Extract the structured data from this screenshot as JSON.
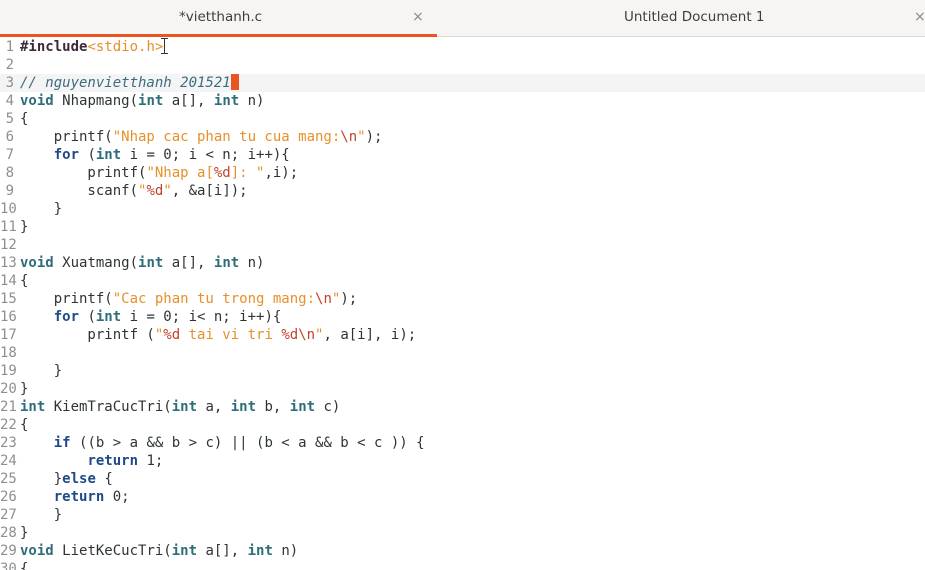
{
  "tabs": [
    {
      "label": "*vietthanh.c",
      "close": "×",
      "active": true
    },
    {
      "label": "Untitled Document 1",
      "close": "×",
      "active": false
    }
  ],
  "colors": {
    "accent": "#e95420",
    "keyword": "#204a87",
    "string": "#e6902a",
    "comment": "#3b6d80"
  },
  "editor": {
    "current_line": 3,
    "lines": [
      {
        "n": "1",
        "tokens": [
          [
            "pp",
            "#include"
          ],
          [
            "inc",
            "<stdio.h>"
          ]
        ]
      },
      {
        "n": "2",
        "tokens": []
      },
      {
        "n": "3",
        "tokens": [
          [
            "cm",
            "// nguyenvietthanh 201521"
          ]
        ]
      },
      {
        "n": "4",
        "tokens": [
          [
            "ty",
            "void"
          ],
          [
            "",
            "Nhapmang("
          ],
          [
            "ty",
            "int"
          ],
          [
            "",
            "a[], "
          ],
          [
            "ty",
            "int"
          ],
          [
            "",
            "n)"
          ]
        ]
      },
      {
        "n": "5",
        "tokens": [
          [
            "",
            "{"
          ]
        ]
      },
      {
        "n": "6",
        "tokens": [
          [
            "",
            "    printf("
          ],
          [
            "str",
            "\"Nhap cac phan tu cua mang:"
          ],
          [
            "esc",
            "\\n"
          ],
          [
            "str",
            "\""
          ],
          [
            "",
            ");"
          ]
        ]
      },
      {
        "n": "7",
        "tokens": [
          [
            "",
            "    "
          ],
          [
            "kw",
            "for"
          ],
          [
            "",
            "("
          ],
          [
            "ty",
            "int"
          ],
          [
            "",
            "i = 0; i < n; i++){"
          ]
        ]
      },
      {
        "n": "8",
        "tokens": [
          [
            "",
            "        printf("
          ],
          [
            "str",
            "\"Nhap a["
          ],
          [
            "esc",
            "%d"
          ],
          [
            "str",
            "]: \""
          ],
          [
            "",
            ",i);"
          ]
        ]
      },
      {
        "n": "9",
        "tokens": [
          [
            "",
            "        scanf("
          ],
          [
            "str",
            "\""
          ],
          [
            "esc",
            "%d"
          ],
          [
            "str",
            "\""
          ],
          [
            "",
            ", &a[i]);"
          ]
        ]
      },
      {
        "n": "10",
        "tokens": [
          [
            "",
            "    }"
          ]
        ]
      },
      {
        "n": "11",
        "tokens": [
          [
            "",
            "}"
          ]
        ]
      },
      {
        "n": "12",
        "tokens": []
      },
      {
        "n": "13",
        "tokens": [
          [
            "ty",
            "void"
          ],
          [
            "",
            "Xuatmang("
          ],
          [
            "ty",
            "int"
          ],
          [
            "",
            "a[], "
          ],
          [
            "ty",
            "int"
          ],
          [
            "",
            "n)"
          ]
        ]
      },
      {
        "n": "14",
        "tokens": [
          [
            "",
            "{"
          ]
        ]
      },
      {
        "n": "15",
        "tokens": [
          [
            "",
            "    printf("
          ],
          [
            "str",
            "\"Cac phan tu trong mang:"
          ],
          [
            "esc",
            "\\n"
          ],
          [
            "str",
            "\""
          ],
          [
            "",
            ");"
          ]
        ]
      },
      {
        "n": "16",
        "tokens": [
          [
            "",
            "    "
          ],
          [
            "kw",
            "for"
          ],
          [
            "",
            "("
          ],
          [
            "ty",
            "int"
          ],
          [
            "",
            "i = 0; i< n; i++){"
          ]
        ]
      },
      {
        "n": "17",
        "tokens": [
          [
            "",
            "        printf ("
          ],
          [
            "str",
            "\""
          ],
          [
            "esc",
            "%d"
          ],
          [
            "str",
            " tai vi tri "
          ],
          [
            "esc",
            "%d\\n"
          ],
          [
            "str",
            "\""
          ],
          [
            "",
            ", a[i], i);"
          ]
        ]
      },
      {
        "n": "18",
        "tokens": []
      },
      {
        "n": "19",
        "tokens": [
          [
            "",
            "    }"
          ]
        ]
      },
      {
        "n": "20",
        "tokens": [
          [
            "",
            "}"
          ]
        ]
      },
      {
        "n": "21",
        "tokens": [
          [
            "ty",
            "int"
          ],
          [
            "",
            "KiemTraCucTri("
          ],
          [
            "ty",
            "int"
          ],
          [
            "",
            "a, "
          ],
          [
            "ty",
            "int"
          ],
          [
            "",
            "b, "
          ],
          [
            "ty",
            "int"
          ],
          [
            "",
            "c)"
          ]
        ]
      },
      {
        "n": "22",
        "tokens": [
          [
            "",
            "{"
          ]
        ]
      },
      {
        "n": "23",
        "tokens": [
          [
            "",
            "    "
          ],
          [
            "kw",
            "if"
          ],
          [
            "",
            "((b > a && b > c) || (b < a && b < c )) {"
          ]
        ]
      },
      {
        "n": "24",
        "tokens": [
          [
            "",
            "        "
          ],
          [
            "kw",
            "return"
          ],
          [
            "",
            "1;"
          ]
        ]
      },
      {
        "n": "25",
        "tokens": [
          [
            "",
            "    }"
          ],
          [
            "kw",
            "else"
          ],
          [
            "",
            "{"
          ]
        ]
      },
      {
        "n": "26",
        "tokens": [
          [
            "",
            "    "
          ],
          [
            "kw",
            "return"
          ],
          [
            "",
            "0;"
          ]
        ]
      },
      {
        "n": "27",
        "tokens": [
          [
            "",
            "    }"
          ]
        ]
      },
      {
        "n": "28",
        "tokens": [
          [
            "",
            "}"
          ]
        ]
      },
      {
        "n": "29",
        "tokens": [
          [
            "ty",
            "void"
          ],
          [
            "",
            "LietKeCucTri("
          ],
          [
            "ty",
            "int"
          ],
          [
            "",
            "a[], "
          ],
          [
            "ty",
            "int"
          ],
          [
            "",
            "n)"
          ]
        ]
      },
      {
        "n": "30",
        "tokens": [
          [
            "",
            "{"
          ]
        ]
      }
    ]
  }
}
